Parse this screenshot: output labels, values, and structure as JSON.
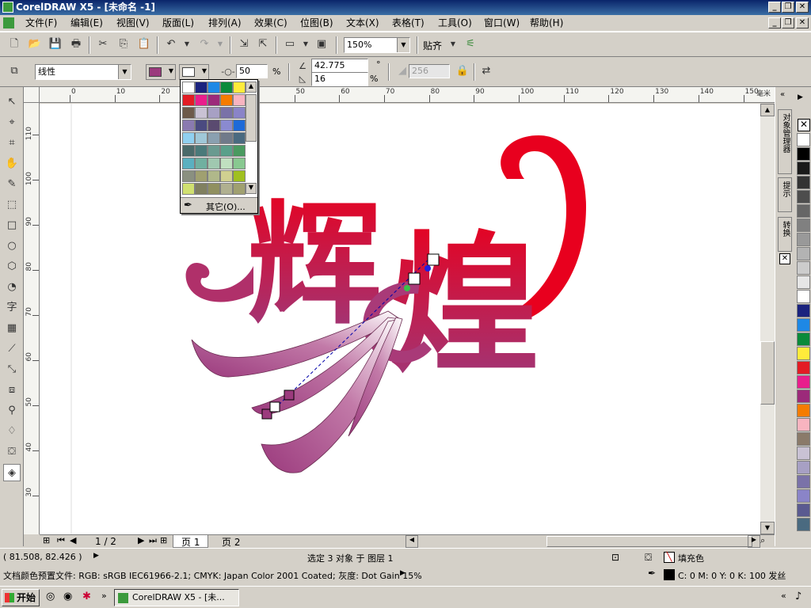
{
  "window": {
    "title": "CorelDRAW X5 - [未命名 -1]"
  },
  "menu": [
    "文件(F)",
    "编辑(E)",
    "视图(V)",
    "版面(L)",
    "排列(A)",
    "效果(C)",
    "位图(B)",
    "文本(X)",
    "表格(T)",
    "工具(O)",
    "窗口(W)",
    "帮助(H)"
  ],
  "toolbar1": {
    "zoom": "150%",
    "snap_label": "贴齐"
  },
  "toolbar2": {
    "blend_preset": "线性",
    "outline_width": "50",
    "angle_top": "42.775",
    "angle_bottom": "16",
    "percent_a": "%",
    "percent_b": "%",
    "degree": "°",
    "disabled_val": "256"
  },
  "fill_popup": {
    "colors": [
      "#ffffff",
      "#1a237e",
      "#1e88e5",
      "#0a8a3a",
      "#ffeb3b",
      "#e31c24",
      "#e91e8c",
      "#9c2a7a",
      "#f57c00",
      "#f8b4c0",
      "#6d5a4a",
      "#c9c2d4",
      "#a7a0c4",
      "#7a72a8",
      "#8a84c8",
      "#8a7ab0",
      "#4a4a80",
      "#5a4a70",
      "#8a8ad0",
      "#1e6ad8",
      "#90d0f0",
      "#a0c8d8",
      "#8aa0b0",
      "#707a8a",
      "#4a6a80",
      "#4a6a6a",
      "#4a7a7a",
      "#6a9a90",
      "#5aa08a",
      "#4a9a60",
      "#5ab0c0",
      "#70b0a0",
      "#a0c8b0",
      "#c0e0c0",
      "#88c890",
      "#8a9080",
      "#a0a070",
      "#b0b88a",
      "#d0d090",
      "#a0c020",
      "#d0e070",
      "#808060",
      "#909060",
      "#b0b090",
      "#a0a070"
    ],
    "other_label": "其它(O)..."
  },
  "ruler_h_labels": [
    "0",
    "10",
    "20",
    "30",
    "40",
    "50",
    "60",
    "70",
    "80",
    "90",
    "100",
    "110",
    "120",
    "130",
    "140",
    "150"
  ],
  "ruler_h_unit": "毫米",
  "ruler_v_labels": [
    "110",
    "100",
    "90",
    "80",
    "70",
    "60",
    "50",
    "40",
    "30"
  ],
  "artwork": {
    "char1": "辉",
    "char2": "煌",
    "gradient_from": "#e8001e",
    "gradient_to": "#9b3a7d"
  },
  "pages": {
    "indicator": "1 / 2",
    "tabs": [
      "页 1",
      "页 2"
    ]
  },
  "dockers": [
    "对象管理器",
    "提示",
    "转换"
  ],
  "palette": [
    "#ffffff",
    "#000000",
    "#1a1a1a",
    "#333333",
    "#4d4d4d",
    "#666666",
    "#808080",
    "#999999",
    "#b3b3b3",
    "#cccccc",
    "#e6e6e6",
    "#ffffff",
    "#1a237e",
    "#1e88e5",
    "#0a8a3a",
    "#ffeb3b",
    "#e31c24",
    "#e91e8c",
    "#9c2a7a",
    "#f57c00",
    "#f8b4c0",
    "#8a7a6a",
    "#c9c2d4",
    "#a7a0c4",
    "#7a72a8",
    "#8a84c8",
    "#5a5a90",
    "#4a6a80"
  ],
  "status": {
    "coords": "( 81.508, 82.426 )",
    "selection": "选定 3 对象 于 图层 1",
    "fill_label": "填充色",
    "profile": "文档颜色预置文件: RGB: sRGB IEC61966-2.1; CMYK: Japan Color 2001 Coated; 灰度: Dot Gain 15%",
    "outline_info": "C: 0 M: 0 Y: 0 K: 100  发丝"
  },
  "taskbar": {
    "start": "开始",
    "task": "CorelDRAW X5 - [未..."
  }
}
